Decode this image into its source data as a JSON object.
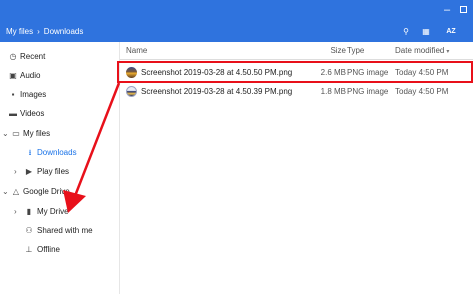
{
  "window": {
    "minimize_glyph": "–",
    "maximize_glyph": ""
  },
  "toolbar": {
    "breadcrumb": [
      "My files",
      "Downloads"
    ],
    "breadcrumb_separator": "›",
    "search_icon": "⚲",
    "grid_icon": "▦",
    "sort_label": "AZ"
  },
  "sidebar": {
    "items": [
      {
        "label": "Recent",
        "icon": "clock-icon",
        "glyph": "◷",
        "chevron": ""
      },
      {
        "label": "Audio",
        "icon": "audio-icon",
        "glyph": "▣",
        "chevron": ""
      },
      {
        "label": "Images",
        "icon": "image-icon",
        "glyph": "▪",
        "chevron": ""
      },
      {
        "label": "Videos",
        "icon": "video-icon",
        "glyph": "▬",
        "chevron": ""
      },
      {
        "label": "My files",
        "icon": "computer-icon",
        "glyph": "▭",
        "chevron": "⌄"
      },
      {
        "label": "Downloads",
        "icon": "download-icon",
        "glyph": "⭳",
        "chevron": ""
      },
      {
        "label": "Play files",
        "icon": "play-icon",
        "glyph": "▶",
        "chevron": "›"
      },
      {
        "label": "Google Drive",
        "icon": "drive-icon",
        "glyph": "△",
        "chevron": "⌄"
      },
      {
        "label": "My Drive",
        "icon": "folder-icon",
        "glyph": "▮",
        "chevron": "›"
      },
      {
        "label": "Shared with me",
        "icon": "people-icon",
        "glyph": "⚇",
        "chevron": ""
      },
      {
        "label": "Offline",
        "icon": "pin-icon",
        "glyph": "⊥",
        "chevron": ""
      }
    ]
  },
  "columns": {
    "name": "Name",
    "size": "Size",
    "type": "Type",
    "modified": "Date modified",
    "sort_arrow": "▾"
  },
  "files": [
    {
      "name": "Screenshot 2019-03-28 at 4.50.50 PM.png",
      "size": "2.6 MB",
      "type": "PNG image",
      "modified": "Today 4:50 PM"
    },
    {
      "name": "Screenshot 2019-03-28 at 4.50.39 PM.png",
      "size": "1.8 MB",
      "type": "PNG image",
      "modified": "Today 4:50 PM"
    }
  ],
  "colors": {
    "accent": "#2f73de",
    "highlight": "#e8101a",
    "active_nav": "#1a73e8"
  }
}
